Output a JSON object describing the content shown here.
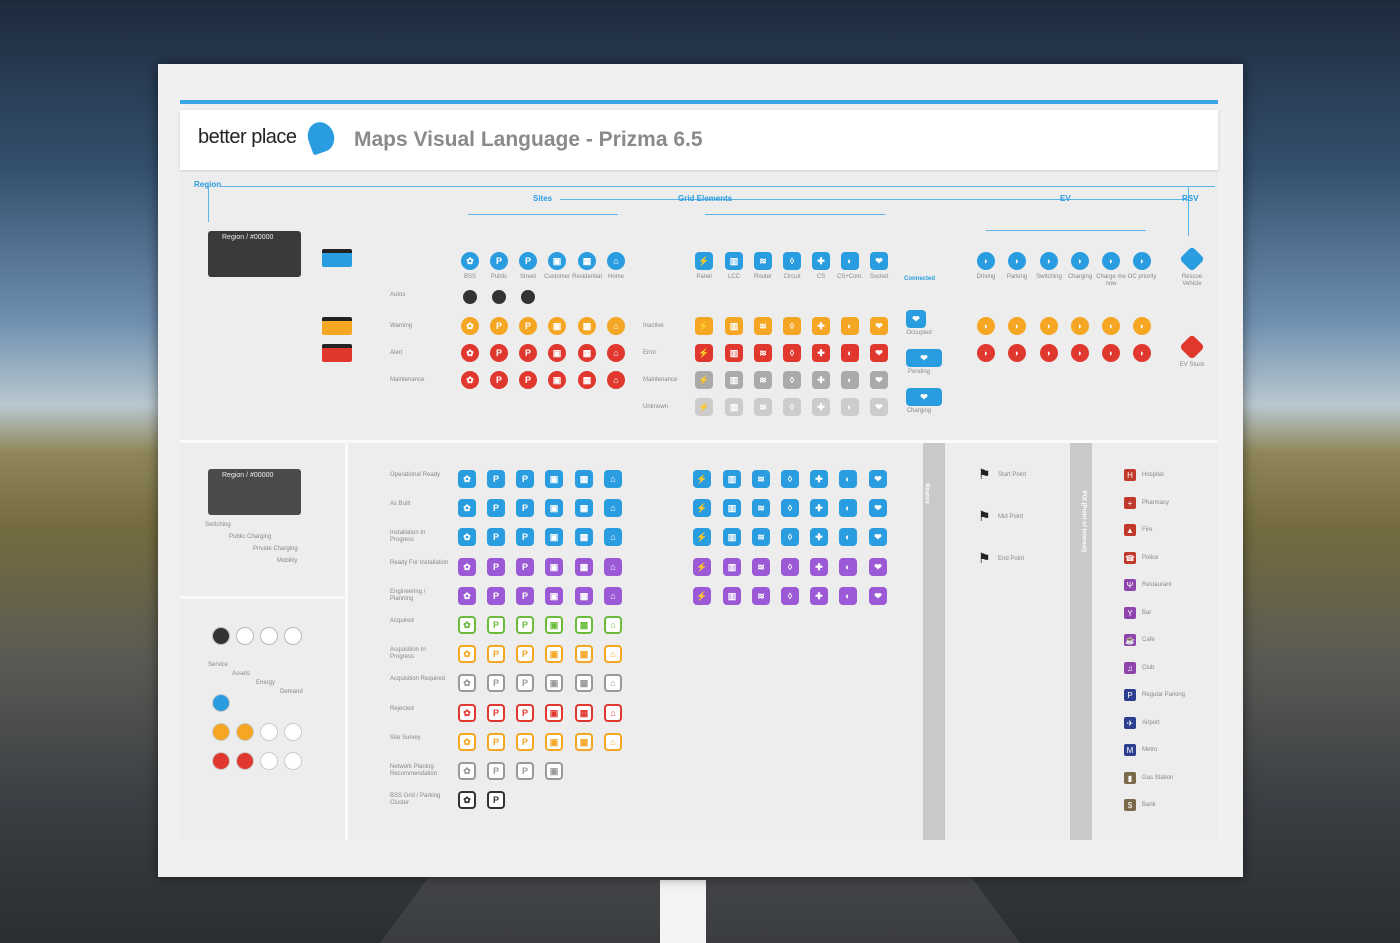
{
  "header": {
    "brand": "better place",
    "title": "Maps Visual Language - Prizma 6.5"
  },
  "groups": {
    "region": "Region",
    "sites": "Sites",
    "grid": "Grid Elements",
    "ev": "EV",
    "rsv": "RSV"
  },
  "region_tab": "Region / #00000",
  "site_types": [
    "BSS",
    "Public",
    "Street",
    "Customer",
    "Residential",
    "Home"
  ],
  "site_glyphs": [
    "✿",
    "P",
    "P",
    "▣",
    "▦",
    "⌂"
  ],
  "grid_types": [
    "Panel",
    "LCC",
    "Router",
    "Circuit",
    "CS",
    "CS+Com.",
    "Socket"
  ],
  "grid_glyphs": [
    "⚡",
    "▥",
    "≋",
    "◊",
    "✚",
    "◐",
    "❤"
  ],
  "connected": "Connected",
  "connected_states": [
    "Occupied",
    "Pending",
    "Charging"
  ],
  "ev_types": [
    "Driving",
    "Parking",
    "Switching",
    "Charging",
    "Charge me now",
    "OC priority"
  ],
  "rsv_types": [
    "Rescue Vehicle",
    "EV Stuck"
  ],
  "row_labels": {
    "autos": "Autos",
    "warning": "Warning",
    "alert": "Alert",
    "maintenance": "Maintenance",
    "inactive": "Inactive",
    "error": "Error",
    "maintenance2": "Maintenance",
    "unknown": "Unknown"
  },
  "status_rows": [
    {
      "label": "Operational Ready",
      "color": "#2a9de0"
    },
    {
      "label": "As Built",
      "color": "#2a9de0"
    },
    {
      "label": "Installation In Progress",
      "color": "#2a9de0"
    },
    {
      "label": "Ready For Installation",
      "color": "#9b59d6"
    },
    {
      "label": "Engineering / Planning",
      "color": "#9b59d6"
    },
    {
      "label": "Acquired",
      "color": "#6cbb3c"
    },
    {
      "label": "Acquisition In Progress",
      "color": "#f5a623"
    },
    {
      "label": "Acquisition Required",
      "color": "#999999"
    },
    {
      "label": "Rejected",
      "color": "#e0382f"
    },
    {
      "label": "Site Survey",
      "color": "#f5a623"
    },
    {
      "label": "Network Planing Recommendation",
      "color": "#999999"
    },
    {
      "label": "BSS Grid / Parking Cluster",
      "color": "#333333"
    }
  ],
  "left_labels": [
    "Switching",
    "Public Charging",
    "Private Charging",
    "Mobility"
  ],
  "service_labels": [
    "Service",
    "Assets",
    "Energy",
    "Demand"
  ],
  "routes": {
    "title": "Routes",
    "items": [
      "Start Point",
      "Mid Point",
      "End Point"
    ]
  },
  "poi": {
    "title": "POI (Point of Interest)",
    "items": [
      {
        "label": "Hospital",
        "glyph": "H",
        "color": "#c0392b"
      },
      {
        "label": "Pharmacy",
        "glyph": "+",
        "color": "#c0392b"
      },
      {
        "label": "Fire",
        "glyph": "▲",
        "color": "#c0392b"
      },
      {
        "label": "Police",
        "glyph": "☎",
        "color": "#c0392b"
      },
      {
        "label": "Restaurant",
        "glyph": "Ψ",
        "color": "#8e44ad"
      },
      {
        "label": "Bar",
        "glyph": "Y",
        "color": "#8e44ad"
      },
      {
        "label": "Cafe",
        "glyph": "☕",
        "color": "#8e44ad"
      },
      {
        "label": "Club",
        "glyph": "♫",
        "color": "#8e44ad"
      },
      {
        "label": "Regular Parking",
        "glyph": "P",
        "color": "#2c3e8f"
      },
      {
        "label": "Airport",
        "glyph": "✈",
        "color": "#2c3e8f"
      },
      {
        "label": "Metro",
        "glyph": "M",
        "color": "#2c3e8f"
      },
      {
        "label": "Gas Station",
        "glyph": "▮",
        "color": "#7a6a4a"
      },
      {
        "label": "Bank",
        "glyph": "$",
        "color": "#7a6a4a"
      }
    ]
  }
}
